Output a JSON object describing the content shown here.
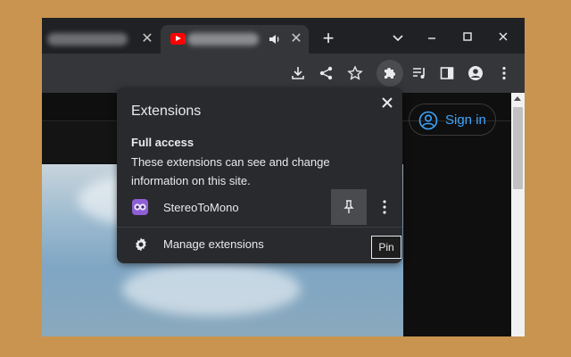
{
  "tabs": [
    {
      "title": "(blurred)",
      "close_label": "✕",
      "icon": "none"
    },
    {
      "title": "(blurred)",
      "close_label": "✕",
      "icon": "youtube-icon",
      "audio": "speaker-icon"
    }
  ],
  "new_tab_label": "+",
  "toolbar": {
    "icons": [
      "download-icon",
      "share-icon",
      "star-icon",
      "puzzle-icon",
      "media-queue-icon",
      "side-panel-icon",
      "profile-icon",
      "kebab-menu-icon"
    ]
  },
  "page": {
    "signin_label": "Sign in"
  },
  "extensions_popup": {
    "title": "Extensions",
    "section_title": "Full access",
    "section_description": "These extensions can see and change information on this site.",
    "extension_name": "StereoToMono",
    "manage_label": "Manage extensions"
  },
  "tooltip_text": "Pin",
  "colors": {
    "background": "#c9944f",
    "frame": "#202124",
    "toolbar": "#35363a",
    "popup": "#292a2d",
    "link": "#3ea6ff"
  }
}
